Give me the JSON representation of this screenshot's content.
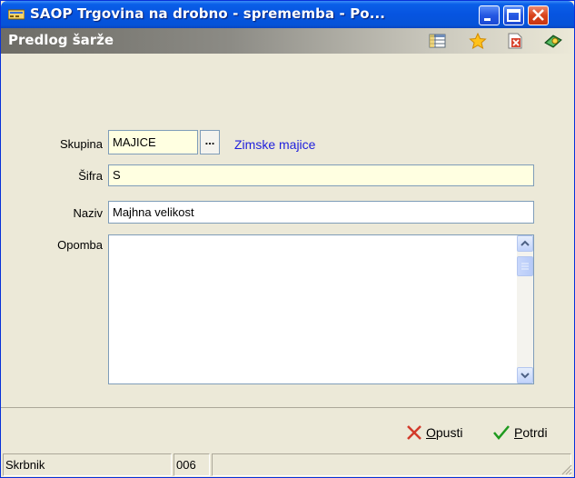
{
  "window": {
    "title": "SAOP Trgovina na drobno - sprememba - Po..."
  },
  "caption": {
    "title": "Predlog šarže",
    "icons": [
      "table-icon",
      "star-icon",
      "delete-doc-icon",
      "help-book-icon"
    ]
  },
  "form": {
    "skupina": {
      "label": "Skupina",
      "value": "MAJICE",
      "browse_label": "...",
      "link_text": "Zimske majice"
    },
    "sifra": {
      "label": "Šifra",
      "value": "S"
    },
    "naziv": {
      "label": "Naziv",
      "value": "Majhna velikost"
    },
    "opomba": {
      "label": "Opomba",
      "value": ""
    }
  },
  "buttons": {
    "cancel": {
      "mnemonic": "O",
      "rest": "pusti"
    },
    "confirm": {
      "mnemonic": "P",
      "rest": "otrdi"
    }
  },
  "status": {
    "user": "Skrbnik",
    "code": "006"
  },
  "colors": {
    "titlebar": "#0654E0",
    "field_highlight": "#FFFFE1",
    "link": "#1F1FDD",
    "cancel_x": "#D23A2A",
    "confirm_check": "#1E9A1E"
  }
}
